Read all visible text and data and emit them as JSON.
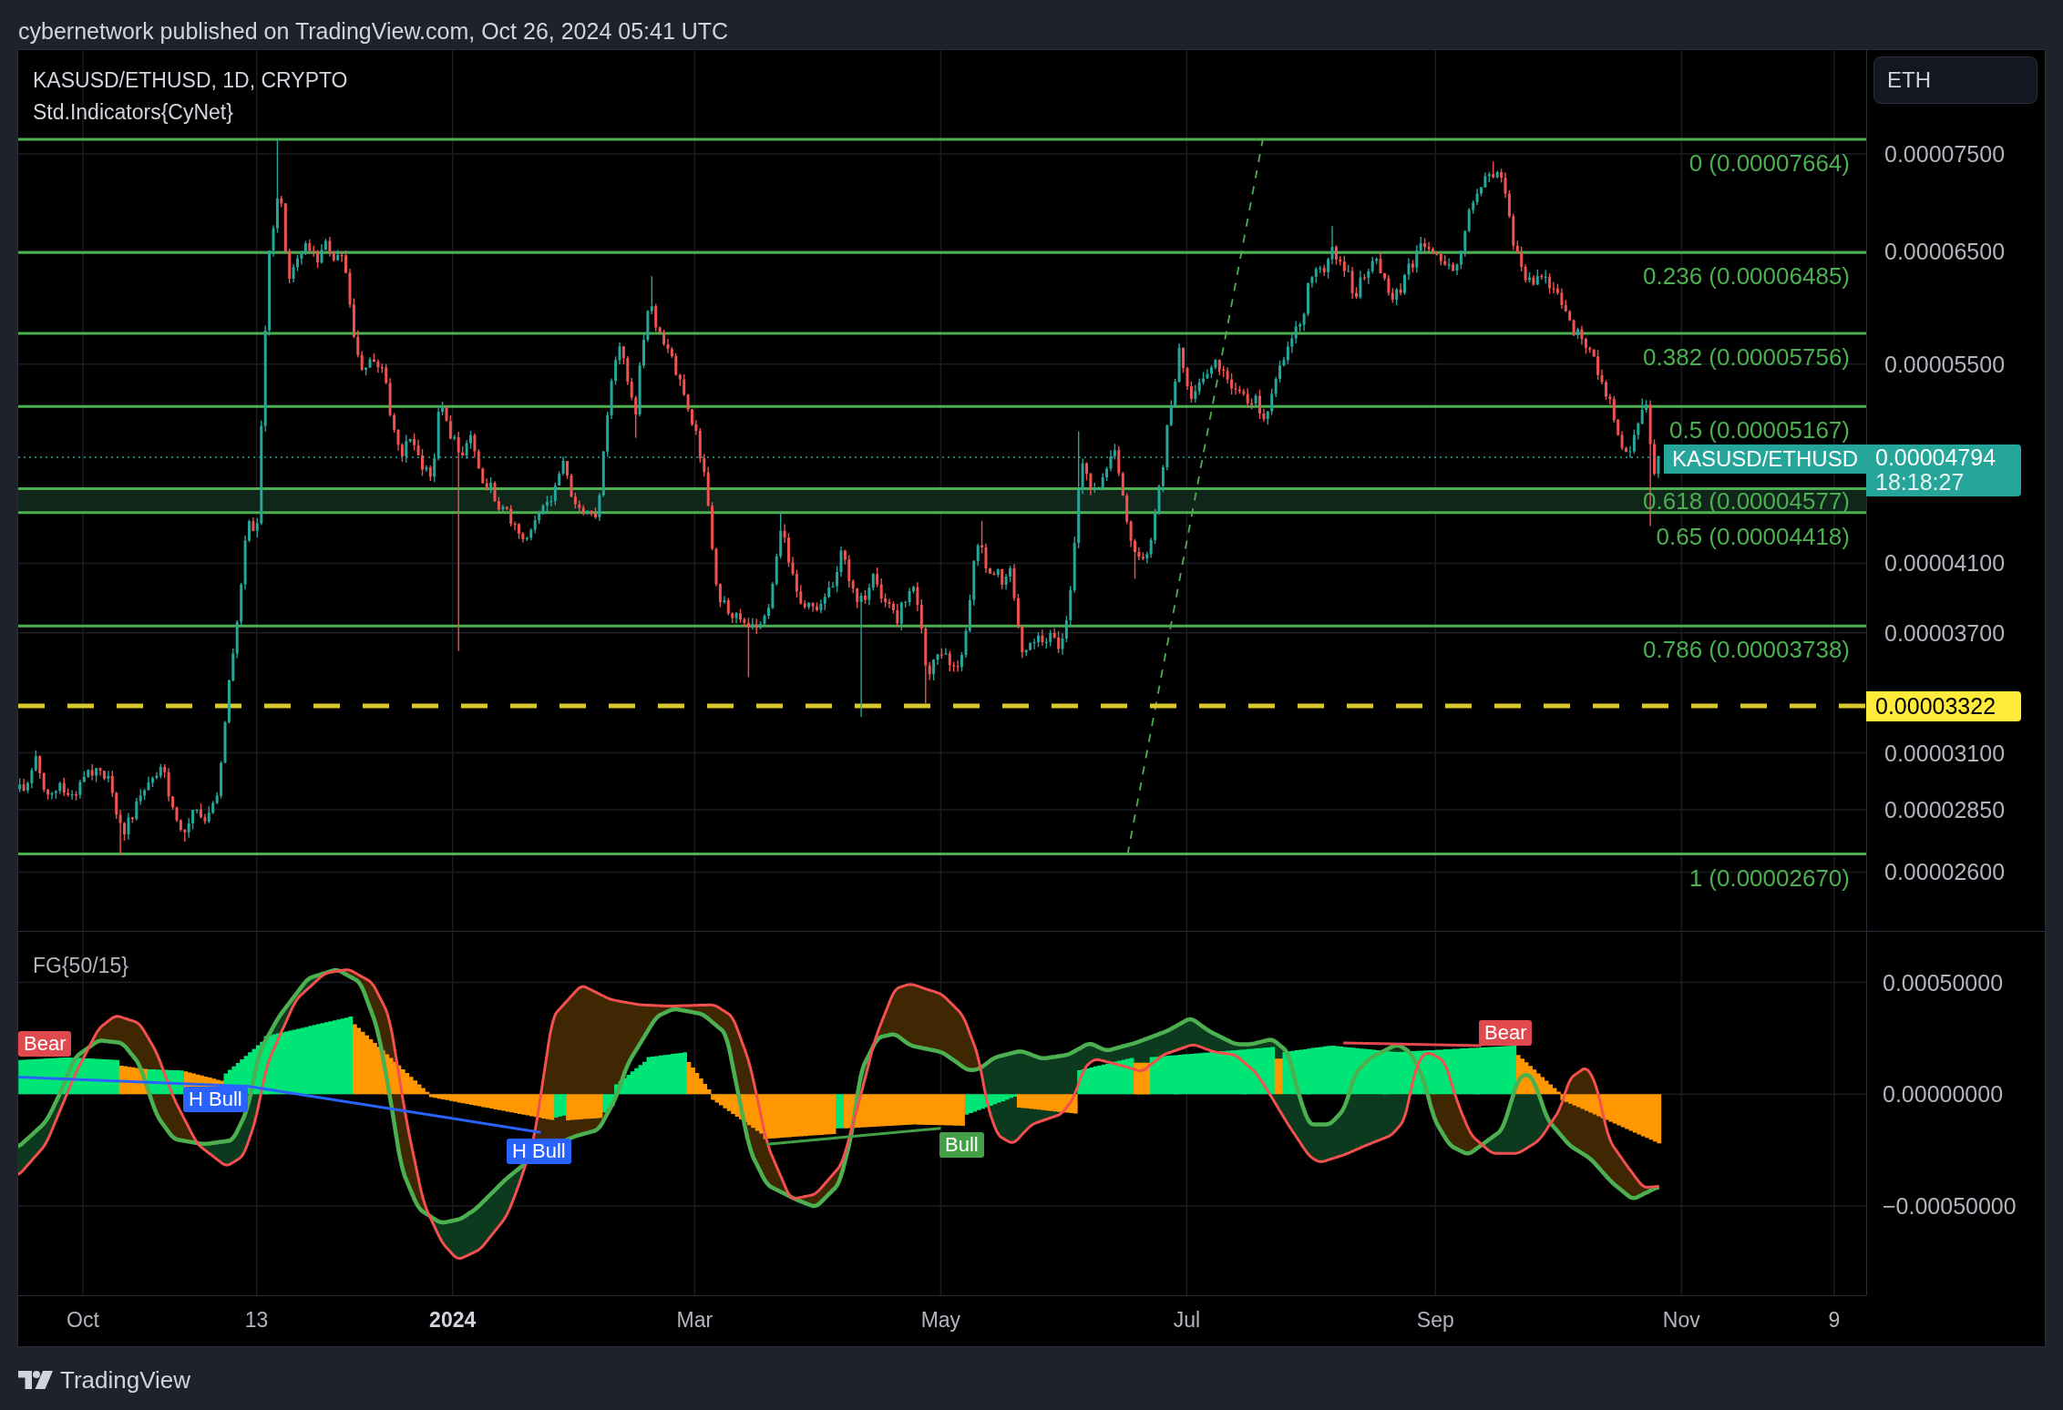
{
  "header": {
    "published": "cybernetwork published on TradingView.com, Oct 26, 2024 05:41 UTC"
  },
  "legend": {
    "symbol": "KASUSD/ETHUSD, 1D, CRYPTO",
    "indicator": "Std.Indicators{CyNet}"
  },
  "currency_button": "ETH",
  "fib_levels": [
    "0 (0.00007664)",
    "0.236 (0.00006485)",
    "0.382 (0.00005756)",
    "0.5 (0.00005167)",
    "0.618 (0.00004577)",
    "0.65 (0.00004418)",
    "0.786 (0.00003738)",
    "1 (0.00002670)"
  ],
  "price_axis": [
    "0.00007500",
    "0.00006500",
    "0.00005500",
    "0.00004100",
    "0.00003700",
    "0.00003100",
    "0.00002850",
    "0.00002600"
  ],
  "last_price": {
    "symbol": "KASUSD/ETHUSD",
    "price": "0.00004794",
    "countdown": "18:18:27"
  },
  "alert_line": {
    "price": "0.00003322"
  },
  "oscillator": {
    "title": "FG{50/15}",
    "axis": [
      "0.00050000",
      "0.00000000",
      "−0.00050000"
    ],
    "signals": [
      {
        "text": "Bear",
        "kind": "bear"
      },
      {
        "text": "H Bull",
        "kind": "hidden_bull"
      },
      {
        "text": "H Bull",
        "kind": "hidden_bull"
      },
      {
        "text": "Bull",
        "kind": "bull"
      },
      {
        "text": "Bear",
        "kind": "bear"
      }
    ]
  },
  "time_axis": [
    {
      "label": "Oct",
      "kind": "date"
    },
    {
      "label": "13",
      "kind": "date"
    },
    {
      "label": "2024",
      "kind": "year"
    },
    {
      "label": "Mar",
      "kind": "date"
    },
    {
      "label": "May",
      "kind": "date"
    },
    {
      "label": "Jul",
      "kind": "date"
    },
    {
      "label": "Sep",
      "kind": "date"
    },
    {
      "label": "Nov",
      "kind": "date"
    },
    {
      "label": "9",
      "kind": "date"
    }
  ],
  "footer": {
    "brand": "TradingView"
  }
}
